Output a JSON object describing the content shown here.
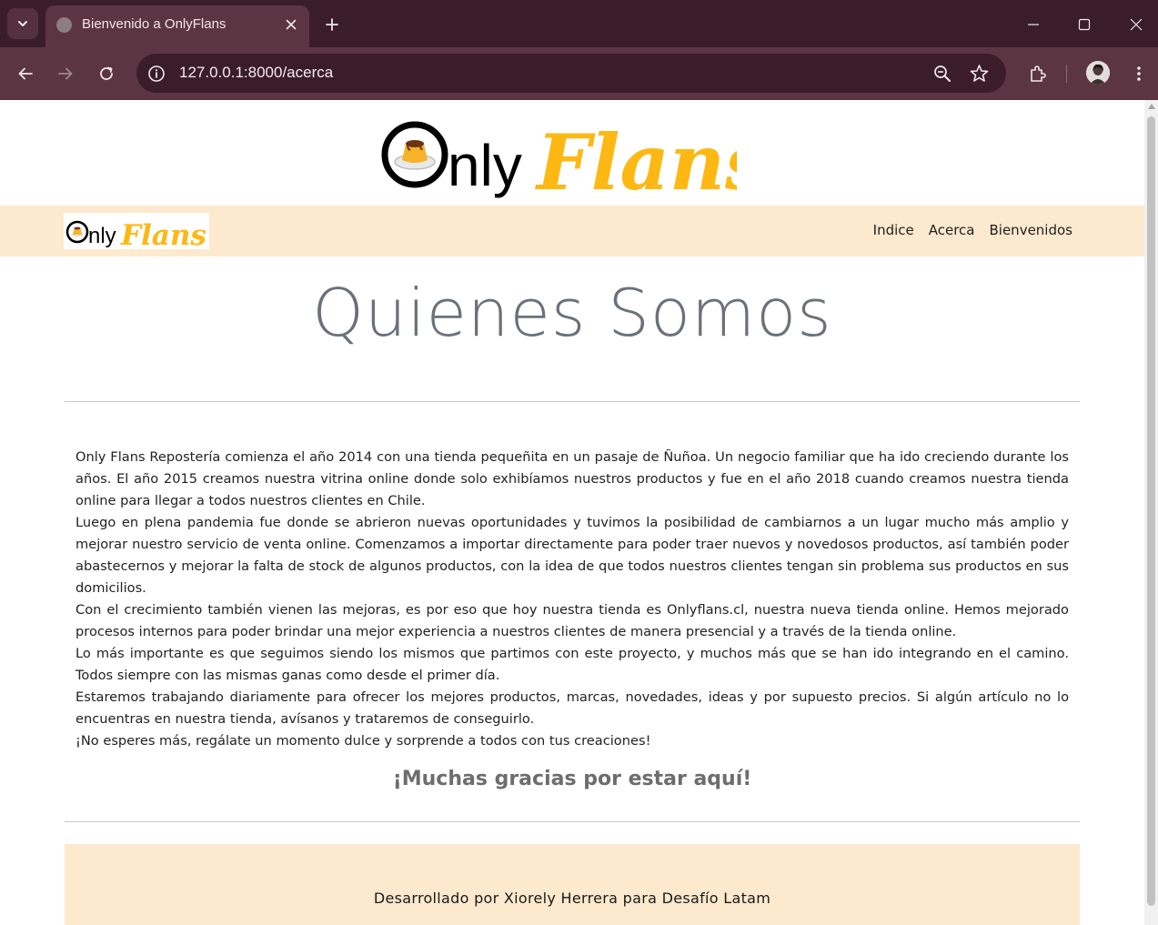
{
  "browser": {
    "tab_title": "Bienvenido a OnlyFlans",
    "url": "127.0.0.1:8000/acerca"
  },
  "page": {
    "logo_text": "OnlyFlans",
    "nav": {
      "links": [
        "Indice",
        "Acerca",
        "Bienvenidos"
      ]
    },
    "heading": "Quienes Somos",
    "paragraphs": [
      "Only Flans Repostería comienza el año 2014 con una tienda pequeñita en un pasaje de Ñuñoa. Un negocio familiar que ha ido creciendo durante los años. El año 2015 creamos nuestra vitrina online donde solo exhibíamos nuestros productos y fue en el año 2018 cuando creamos nuestra tienda online para llegar a todos nuestros clientes en Chile.",
      "Luego en plena pandemia fue donde se abrieron nuevas oportunidades y tuvimos la posibilidad de cambiarnos a un lugar mucho más amplio y mejorar nuestro servicio de venta online. Comenzamos a importar directamente para poder traer nuevos y novedosos productos, así también poder abastecernos y mejorar la falta de stock de algunos productos, con la idea de que todos nuestros clientes tengan sin problema sus productos en sus domicilios.",
      "Con el crecimiento también vienen las mejoras, es por eso que hoy nuestra tienda es Onlyflans.cl, nuestra nueva tienda online. Hemos mejorado procesos internos para poder brindar una mejor experiencia a nuestros clientes de manera presencial y a través de la tienda online.",
      "Lo más importante es que seguimos siendo los mismos que partimos con este proyecto, y muchos más que se han ido integrando en el camino. Todos siempre con las mismas ganas como desde el primer día.",
      "Estaremos trabajando diariamente para ofrecer los mejores productos, marcas, novedades, ideas y por supuesto precios. Si algún artículo no lo encuentras en nuestra tienda, avísanos y trataremos de conseguirlo.",
      "¡No esperes más, regálate un momento dulce y sorprende a todos con tus creaciones!"
    ],
    "thanks": "¡Muchas gracias por estar aquí!",
    "footer": "Desarrollado por Xiorely Herrera para Desafío Latam"
  },
  "colors": {
    "chrome_dark": "#3b1d2a",
    "chrome_toolbar": "#5c3542",
    "brand_yellow": "#fdb813",
    "nav_bg": "#fde9cd",
    "heading_gray": "#6a717a"
  },
  "icons": [
    "tab-search-icon",
    "globe-icon",
    "close-icon",
    "plus-icon",
    "minimize-icon",
    "maximize-icon",
    "window-close-icon",
    "back-icon",
    "forward-icon",
    "reload-icon",
    "site-info-icon",
    "zoom-icon",
    "star-icon",
    "extensions-icon",
    "more-icon"
  ]
}
